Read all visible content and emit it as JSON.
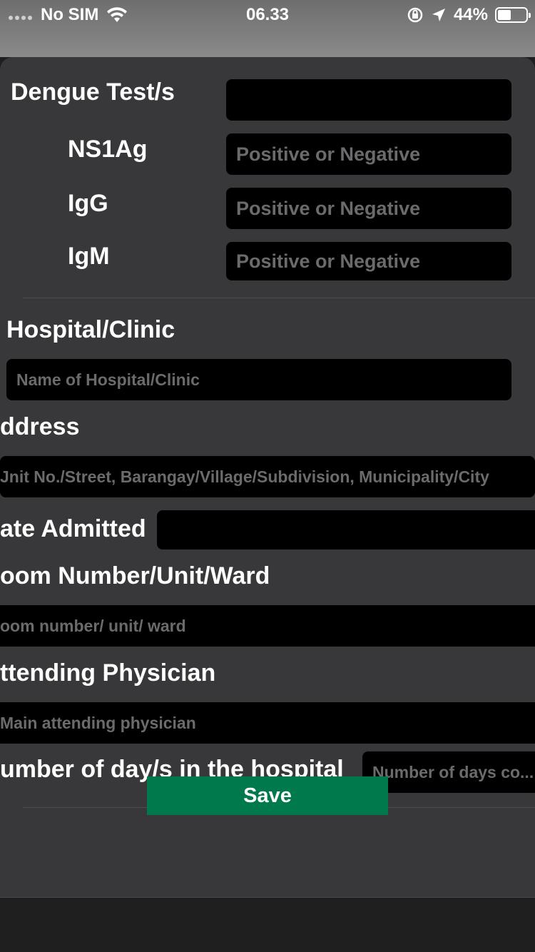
{
  "status_bar": {
    "carrier": "No SIM",
    "time": "06.33",
    "battery": "44%",
    "battery_level": 0.44
  },
  "form": {
    "dengue": {
      "label": "Dengue Test/s",
      "value": "",
      "ns1ag": {
        "label": "NS1Ag",
        "placeholder": "Positive or Negative"
      },
      "igg": {
        "label": "IgG",
        "placeholder": "Positive or Negative"
      },
      "igm": {
        "label": "IgM",
        "placeholder": "Positive or Negative"
      }
    },
    "hospital": {
      "label": "Hospital/Clinic",
      "placeholder": "Name of Hospital/Clinic"
    },
    "address": {
      "label": "ddress",
      "placeholder": "Jnit No./Street, Barangay/Village/Subdivision, Municipality/City"
    },
    "date_admitted": {
      "label": "ate Admitted",
      "value": ""
    },
    "room": {
      "label": "oom Number/Unit/Ward",
      "placeholder": "oom number/ unit/ ward"
    },
    "physician": {
      "label": "ttending Physician",
      "placeholder": "Main attending physician"
    },
    "days": {
      "label": "umber of day/s in the hospital",
      "placeholder": "Number of days co..."
    }
  },
  "actions": {
    "save_label": "Save"
  },
  "colors": {
    "sheet": "#38383a",
    "field": "#000000",
    "save": "#007a4c",
    "placeholder": "#6b6b6e"
  }
}
